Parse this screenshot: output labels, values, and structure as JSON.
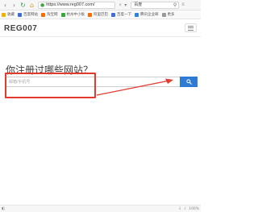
{
  "browser": {
    "url": "https://www.reg007.com/",
    "search_engine": "百度",
    "zoom": "100%"
  },
  "bookmarks": [
    {
      "label": "收藏",
      "color": "#f0b400"
    },
    {
      "label": "百度网站",
      "color": "#3b6fd6"
    },
    {
      "label": "淘宝网",
      "color": "#ff6a00"
    },
    {
      "label": "杭州中小板",
      "color": "#37a93a"
    },
    {
      "label": "阿里巴巴",
      "color": "#ff6a00"
    },
    {
      "label": "百度一下",
      "color": "#3b6fd6"
    },
    {
      "label": "腾讯企业邮",
      "color": "#2a82e4"
    },
    {
      "label": "更多",
      "color": "#999999"
    }
  ],
  "site": {
    "logo": "REG007"
  },
  "main": {
    "heading": "你注册过哪些网站？",
    "input_placeholder": "邮箱/手机号"
  },
  "colors": {
    "accent": "#2e7bd6",
    "annotation": "#e23a2e"
  }
}
